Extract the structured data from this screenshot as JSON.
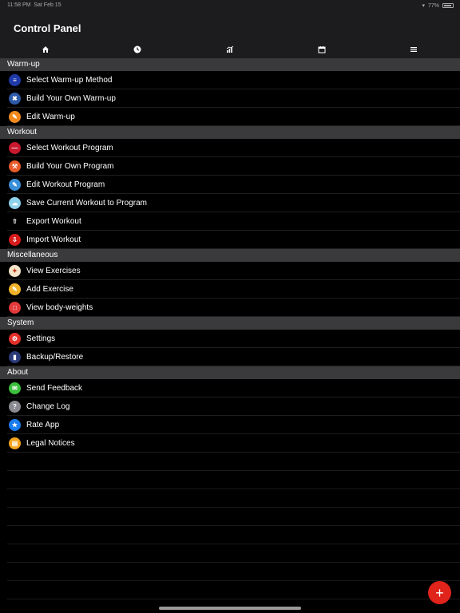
{
  "status": {
    "time": "11:58 PM",
    "date": "Sat Feb 15",
    "battery": "77%"
  },
  "header": {
    "title": "Control Panel"
  },
  "tabs": [
    {
      "icon": "home-icon"
    },
    {
      "icon": "clock-icon"
    },
    {
      "icon": "chart-icon"
    },
    {
      "icon": "calendar-icon"
    },
    {
      "icon": "menu-icon"
    }
  ],
  "sections": {
    "warmup": {
      "title": "Warm-up",
      "items": [
        "Select Warm-up Method",
        "Build Your Own Warm-up",
        "Edit Warm-up"
      ]
    },
    "workout": {
      "title": "Workout",
      "items": [
        "Select Workout Program",
        "Build Your Own Program",
        "Edit Workout Program",
        "Save Current Workout to Program",
        "Export Workout",
        "Import Workout"
      ]
    },
    "misc": {
      "title": "Miscellaneous",
      "items": [
        "View Exercises",
        "Add Exercise",
        "View body-weights"
      ]
    },
    "system": {
      "title": "System",
      "items": [
        "Settings",
        "Backup/Restore"
      ]
    },
    "about": {
      "title": "About",
      "items": [
        "Send Feedback",
        "Change Log",
        "Rate App",
        "Legal Notices"
      ]
    }
  },
  "fab": {
    "label": "+"
  },
  "colors": {
    "accent": "#e0231b",
    "header_bg": "#1c1c1e",
    "section_bg": "#3a3a3c"
  }
}
